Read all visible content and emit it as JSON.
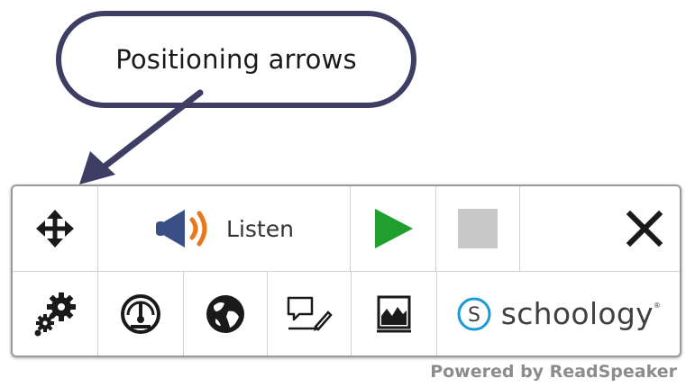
{
  "callout": {
    "text": "Positioning arrows"
  },
  "toolbar": {
    "top_row": [
      {
        "name": "move",
        "icon": "move-arrows-icon"
      },
      {
        "name": "listen",
        "icon": "speaker-icon",
        "label": "Listen"
      },
      {
        "name": "play",
        "icon": "play-icon"
      },
      {
        "name": "stop",
        "icon": "stop-icon"
      },
      {
        "name": "close",
        "icon": "close-icon"
      }
    ],
    "bottom_row": [
      {
        "name": "settings",
        "icon": "gears-icon"
      },
      {
        "name": "speed",
        "icon": "speedometer-icon"
      },
      {
        "name": "translate",
        "icon": "globe-icon"
      },
      {
        "name": "text-mode",
        "icon": "pen-note-icon"
      },
      {
        "name": "picture-dictionary",
        "icon": "image-chart-icon"
      },
      {
        "name": "schoology",
        "icon": "schoology-logo-icon",
        "label": "schoology",
        "tm": "®"
      }
    ]
  },
  "footer": {
    "powered_by": "Powered by ReadSpeaker"
  },
  "colors": {
    "callout_border": "#3e3d63",
    "speaker_orange": "#e8771e",
    "speaker_navy": "#3a4f86",
    "play_green": "#1e9f2e",
    "stop_gray": "#c8c8c8",
    "schoology_blue": "#1a9ad6"
  }
}
